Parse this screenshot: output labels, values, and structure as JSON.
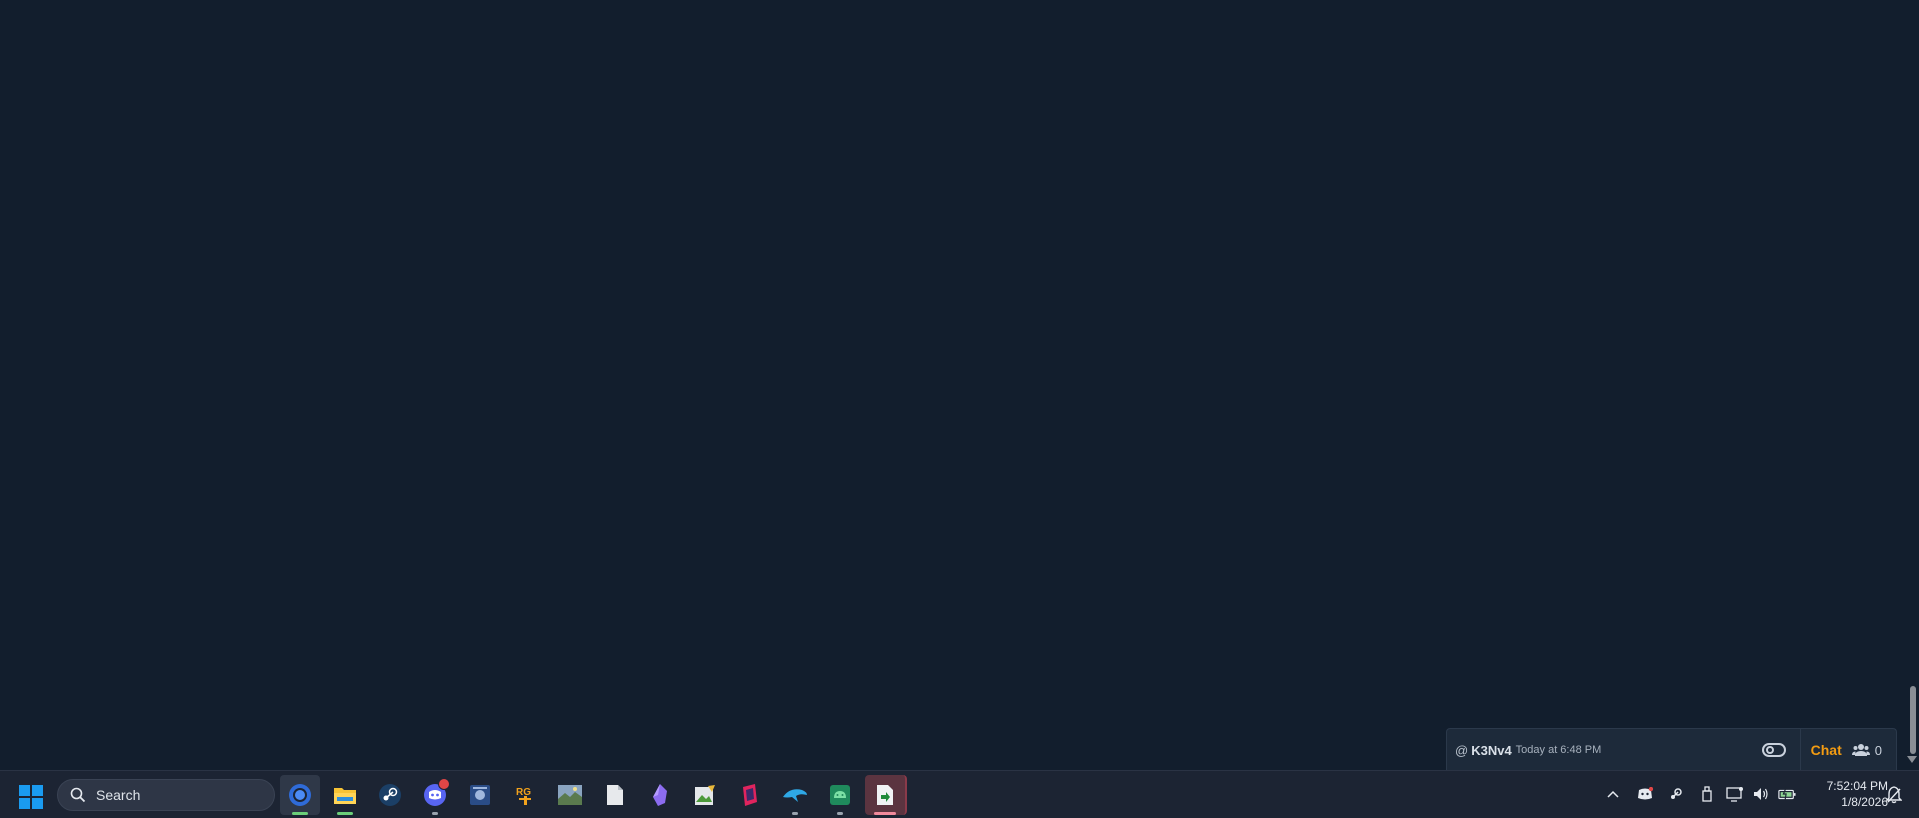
{
  "chat": {
    "at_symbol": "@",
    "username": "K3Nv4",
    "timestamp": "Today at 6:48 PM",
    "chat_label": "Chat",
    "online_count": "0",
    "accent_color": "#f39c12"
  },
  "taskbar": {
    "search_label": "Search",
    "apps": [
      {
        "name": "chrome-icon",
        "state": "active"
      },
      {
        "name": "file-explorer-icon",
        "state": "running"
      },
      {
        "name": "steam-icon",
        "state": "none"
      },
      {
        "name": "discord-icon",
        "state": "running"
      },
      {
        "name": "app-blue-icon",
        "state": "none"
      },
      {
        "name": "rg-app-icon",
        "state": "none"
      },
      {
        "name": "photos-icon",
        "state": "none"
      },
      {
        "name": "document-icon",
        "state": "none"
      },
      {
        "name": "obsidian-icon",
        "state": "none"
      },
      {
        "name": "image-editor-icon",
        "state": "none"
      },
      {
        "name": "magenta-app-icon",
        "state": "none"
      },
      {
        "name": "dolphin-icon",
        "state": "running"
      },
      {
        "name": "android-icon",
        "state": "running"
      },
      {
        "name": "spreadsheet-export-icon",
        "state": "active"
      }
    ],
    "clock_time": "7:52:04 PM",
    "clock_date": "1/8/2026"
  }
}
